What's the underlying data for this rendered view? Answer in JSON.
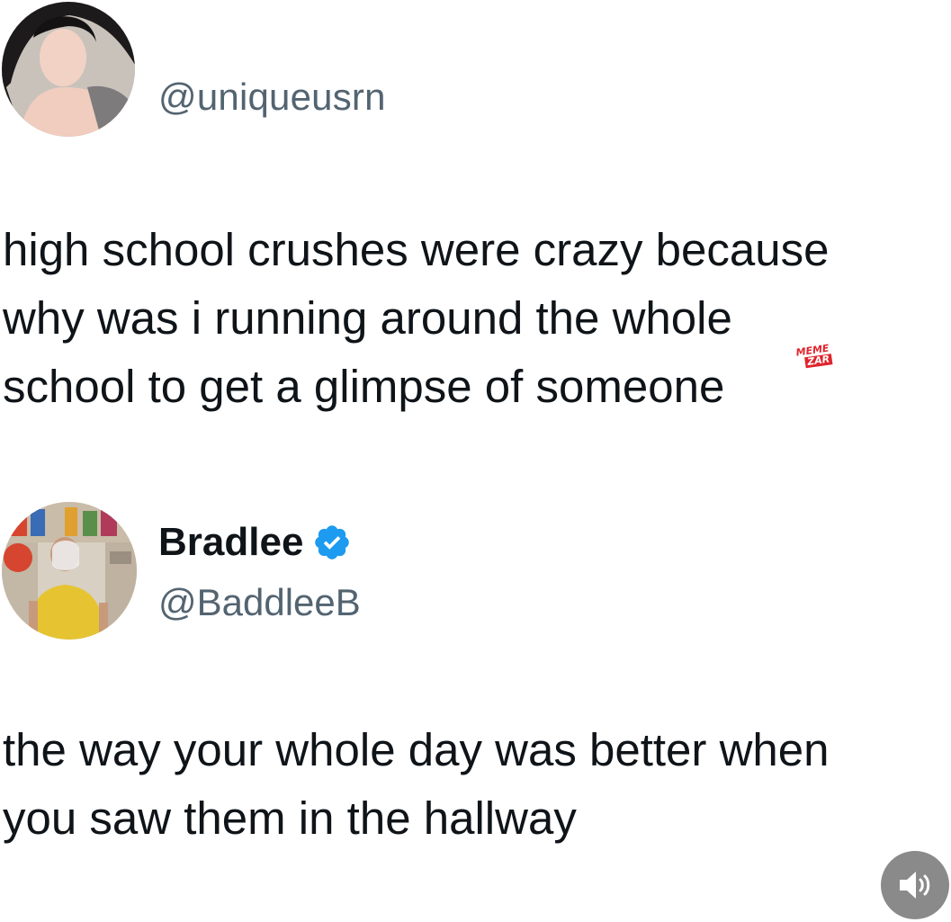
{
  "tweets": [
    {
      "handle": "@uniqueusrn",
      "lines": [
        "high school crushes were crazy because",
        "why was i running around the whole",
        "school to get a glimpse of someone"
      ]
    },
    {
      "display_name": "Bradlee",
      "verified_icon": "verified-badge-icon",
      "handle": "@BaddleeB",
      "lines": [
        "the way your whole day was better when",
        "you saw them in the hallway"
      ]
    }
  ],
  "watermark": {
    "line1": "MEME",
    "line2": "ZAR"
  },
  "controls": {
    "sound_icon": "speaker-icon"
  },
  "colors": {
    "text": "#0f1419",
    "handle": "#536471",
    "verified": "#1d9bf0",
    "watermark": "#e0242c",
    "sound_button": "#8a8a8a"
  }
}
